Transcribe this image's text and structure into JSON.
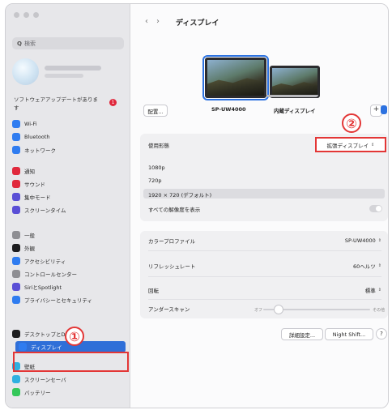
{
  "sidebar": {
    "search_placeholder": "検索",
    "update_notice": "ソフトウェアアップデートがあります",
    "update_badge": "1",
    "items": [
      {
        "label": "Wi-Fi",
        "icon": "wifi-icon",
        "color": "#2f7cf0"
      },
      {
        "label": "Bluetooth",
        "icon": "bluetooth-icon",
        "color": "#2f7cf0"
      },
      {
        "label": "ネットワーク",
        "icon": "globe-icon",
        "color": "#2f7cf0"
      },
      {
        "label": "通知",
        "icon": "bell-icon",
        "color": "#e0283c"
      },
      {
        "label": "サウンド",
        "icon": "speaker-icon",
        "color": "#e0283c"
      },
      {
        "label": "集中モード",
        "icon": "moon-icon",
        "color": "#5a4fd6"
      },
      {
        "label": "スクリーンタイム",
        "icon": "hourglass-icon",
        "color": "#5a4fd6"
      },
      {
        "label": "一般",
        "icon": "gear-icon",
        "color": "#8e8e93"
      },
      {
        "label": "外観",
        "icon": "appearance-icon",
        "color": "#1d1d1f"
      },
      {
        "label": "アクセシビリティ",
        "icon": "accessibility-icon",
        "color": "#2f7cf0"
      },
      {
        "label": "コントロールセンター",
        "icon": "control-center-icon",
        "color": "#8e8e93"
      },
      {
        "label": "SiriとSpotlight",
        "icon": "siri-icon",
        "color": "#5a4fd6"
      },
      {
        "label": "プライバシーとセキュリティ",
        "icon": "hand-icon",
        "color": "#2f7cf0"
      },
      {
        "label": "デスクトップとDock",
        "icon": "dock-icon",
        "color": "#1d1d1f"
      },
      {
        "label": "ディスプレイ",
        "icon": "sun-icon",
        "color": "#2f7cf0"
      },
      {
        "label": "壁紙",
        "icon": "wallpaper-icon",
        "color": "#2fb0e0"
      },
      {
        "label": "スクリーンセーバ",
        "icon": "screensaver-icon",
        "color": "#2fb0e0"
      },
      {
        "label": "バッテリー",
        "icon": "battery-icon",
        "color": "#34c759"
      }
    ]
  },
  "annotations": {
    "one": "①",
    "two": "②"
  },
  "header": {
    "back": "‹",
    "forward": "›",
    "title": "ディスプレイ"
  },
  "displays": {
    "arrange_label": "配置...",
    "external_name": "SP-UW4000",
    "internal_name": "内蔵ディスプレイ",
    "add_label": "+"
  },
  "settings": {
    "use_as_label": "使用形態",
    "use_as_value": "拡張ディスプレイ",
    "resolutions": [
      "1080p",
      "720p",
      "1920 × 720 (デフォルト)"
    ],
    "show_all_label": "すべての解像度を表示",
    "color_profile_label": "カラープロファイル",
    "color_profile_value": "SP-UW4000",
    "refresh_label": "リフレッシュレート",
    "refresh_value": "60ヘルツ",
    "rotation_label": "回転",
    "rotation_value": "標準",
    "underscan_label": "アンダースキャン",
    "underscan_min": "オフ",
    "underscan_max": "その他",
    "underscan_level": 0.05
  },
  "footer": {
    "advanced_label": "詳細設定...",
    "nightshift_label": "Night Shift...",
    "help_label": "?"
  }
}
